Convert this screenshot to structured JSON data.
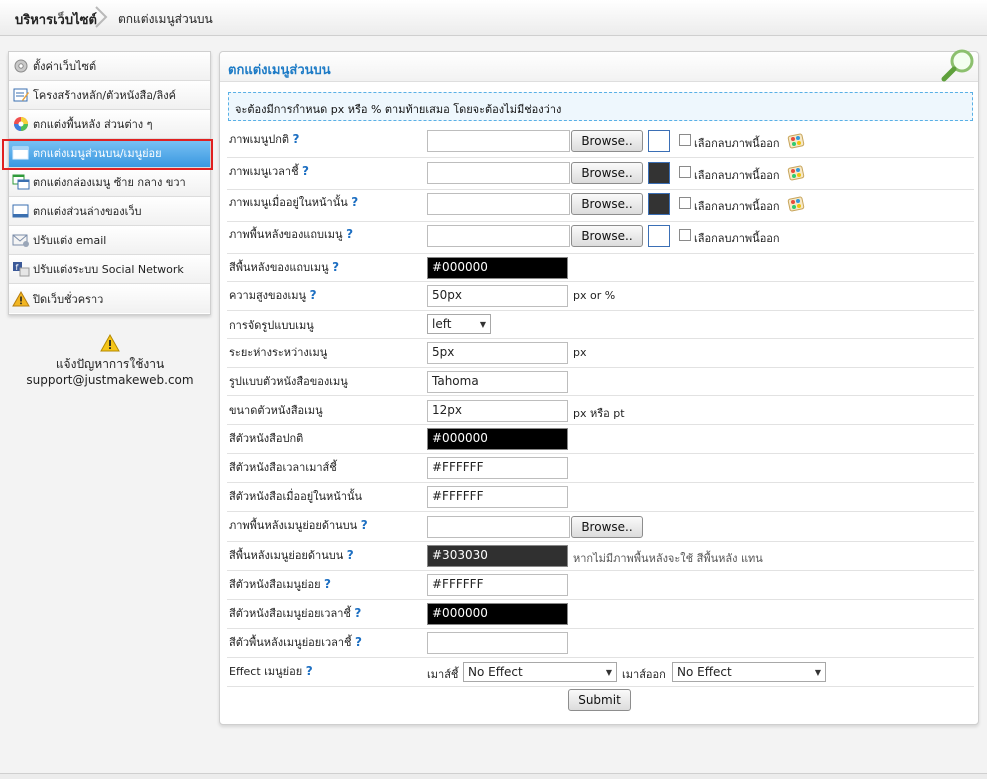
{
  "breadcrumb": {
    "home": "บริหารเว็บไซต์",
    "current": "ตกแต่งเมนูส่วนบน"
  },
  "sidebar": {
    "items": [
      {
        "label": "ตั้งค่าเว็บไซต์",
        "icon": "gear-icon"
      },
      {
        "label": "โครงสร้างหลัก/ตัวหนังสือ/ลิงค์",
        "icon": "edit-icon"
      },
      {
        "label": "ตกแต่งพื้นหลัง ส่วนต่าง ๆ",
        "icon": "color-wheel-icon"
      },
      {
        "label": "ตกแต่งเมนูส่วนบน/เมนูย่อย",
        "icon": "window-icon"
      },
      {
        "label": "ตกแต่งกล่องเมนู ซ้าย กลาง ขวา",
        "icon": "windows-icon"
      },
      {
        "label": "ตกแต่งส่วนล่างของเว็บ",
        "icon": "footer-window-icon"
      },
      {
        "label": "ปรับแต่ง email",
        "icon": "email-settings-icon"
      },
      {
        "label": "ปรับแต่งระบบ Social Network",
        "icon": "social-network-icon"
      },
      {
        "label": "ปิดเว็บชั่วคราว",
        "icon": "warning-icon"
      }
    ]
  },
  "support": {
    "line1": "แจ้งปัญหาการใช้งาน",
    "email": "support@justmakeweb.com"
  },
  "panel": {
    "title": "ตกแต่งเมนูส่วนบน",
    "notice": "จะต้องมีการกำหนด px หรือ % ตามท้ายเสมอ โดยจะต้องไม่มีช่องว่าง",
    "help": "?",
    "browse_label": "Browse..",
    "remove_image_label": "เลือกลบภาพนี้ออก",
    "rows": {
      "menu_image_normal": "ภาพเมนูปกติ",
      "menu_image_hover": "ภาพเมนูเวลาชี้",
      "menu_image_current": "ภาพเมนูเมื่ออยู่ในหน้านั้น",
      "menu_bar_bg_image": "ภาพพื้นหลังของแถบเมนู",
      "menu_bar_bg_color": {
        "label": "สีพื้นหลังของแถบเมนู",
        "value": "#000000"
      },
      "menu_height": {
        "label": "ความสูงของเมนู",
        "value": "50px",
        "unit": "px or %"
      },
      "menu_align": {
        "label": "การจัดรูปแบบเมนู",
        "value": "left"
      },
      "menu_spacing": {
        "label": "ระยะห่างระหว่างเมนู",
        "value": "5px",
        "unit": "px"
      },
      "menu_font": {
        "label": "รูปแบบตัวหนังสือของเมนู",
        "value": "Tahoma"
      },
      "menu_font_size": {
        "label": "ขนาดตัวหนังสือเมนู",
        "value": "12px",
        "unit": "px หรือ pt"
      },
      "menu_text_color": {
        "label": "สีตัวหนังสือปกติ",
        "value": "#000000"
      },
      "menu_text_hover_color": {
        "label": "สีตัวหนังสือเวลาเมาส์ชี้",
        "value": "#FFFFFF"
      },
      "menu_text_current_color": {
        "label": "สีตัวหนังสือเมื่ออยู่ในหน้านั้น",
        "value": "#FFFFFF"
      },
      "submenu_bg_image": {
        "label": "ภาพพื้นหลังเมนูย่อยด้านบน"
      },
      "submenu_bg_color": {
        "label": "สีพื้นหลังเมนูย่อยด้านบน",
        "value": "#303030",
        "note": "หากไม่มีภาพพื้นหลังจะใช้ สีพื้นหลัง แทน"
      },
      "submenu_text_color": {
        "label": "สีตัวหนังสือเมนูย่อย",
        "value": "#FFFFFF"
      },
      "submenu_text_hover_color": {
        "label": "สีตัวหนังสือเมนูย่อยเวลาชี้",
        "value": "#000000"
      },
      "submenu_bg_hover_color": {
        "label": "สีตัวพื้นหลังเมนูย่อยเวลาชี้",
        "value": ""
      },
      "submenu_effect": {
        "label": "Effect เมนูย่อย",
        "in_label": "เมาส์ชี้",
        "in_value": "No Effect",
        "out_label": "เมาส์ออก",
        "out_value": "No Effect"
      }
    },
    "submit_label": "Submit"
  },
  "colors": {
    "accent": "#1d7bc6",
    "active_item": "#3a98e0",
    "highlight_border": "#e02020"
  }
}
